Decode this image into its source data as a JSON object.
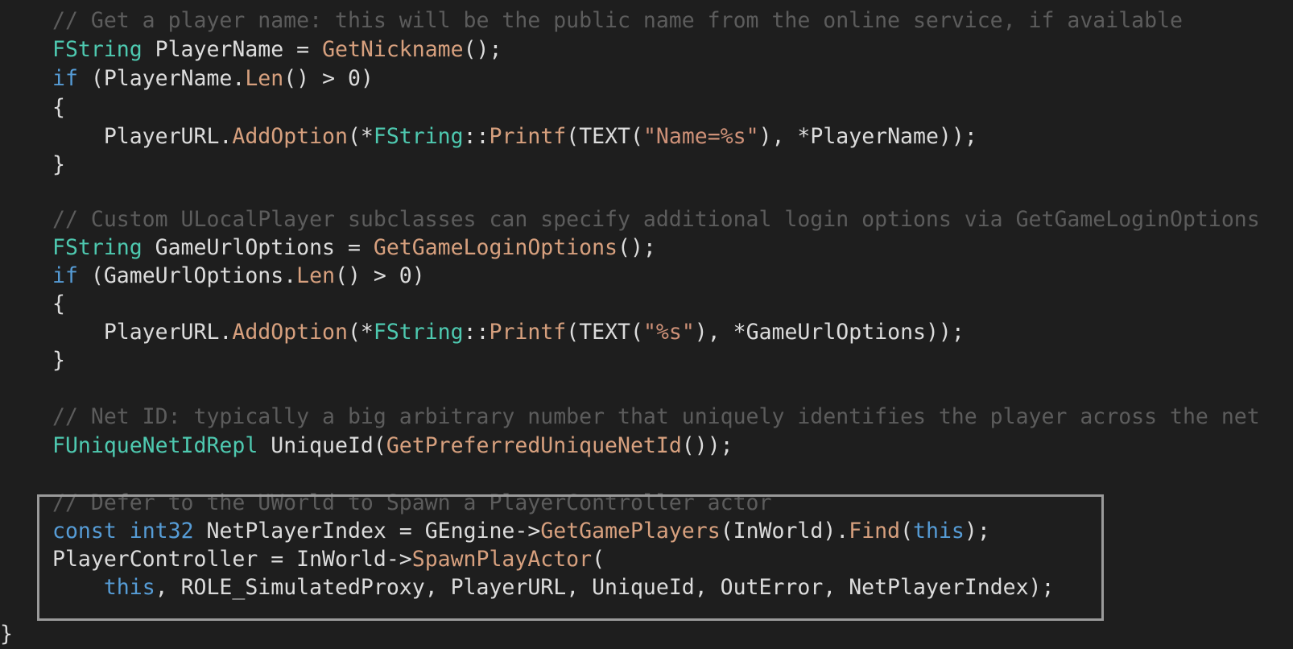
{
  "colors": {
    "background": "#1e1e1e",
    "comment": "#5c5c5c",
    "type": "#4ec9b0",
    "keyword": "#569cd6",
    "function": "#d7a07e",
    "string": "#ce9178",
    "plain": "#dcdcdc",
    "highlight_border": "#9a9a9a"
  },
  "code": {
    "lines": [
      [
        {
          "t": "// Get a player name: this will be the public name from the online service, if available",
          "k": "comment"
        }
      ],
      [
        {
          "t": "FString",
          "k": "type"
        },
        {
          "t": " PlayerName = ",
          "k": "plain"
        },
        {
          "t": "GetNickname",
          "k": "func"
        },
        {
          "t": "();",
          "k": "plain"
        }
      ],
      [
        {
          "t": "if",
          "k": "keyword"
        },
        {
          "t": " (PlayerName.",
          "k": "plain"
        },
        {
          "t": "Len",
          "k": "func"
        },
        {
          "t": "() > 0)",
          "k": "plain"
        }
      ],
      [
        {
          "t": "{",
          "k": "plain"
        }
      ],
      [
        {
          "t": "    PlayerURL.",
          "k": "plain"
        },
        {
          "t": "AddOption",
          "k": "func"
        },
        {
          "t": "(*",
          "k": "plain"
        },
        {
          "t": "FString",
          "k": "type"
        },
        {
          "t": "::",
          "k": "plain"
        },
        {
          "t": "Printf",
          "k": "func"
        },
        {
          "t": "(TEXT(",
          "k": "plain"
        },
        {
          "t": "\"Name=%s\"",
          "k": "string"
        },
        {
          "t": "), *PlayerName));",
          "k": "plain"
        }
      ],
      [
        {
          "t": "}",
          "k": "plain"
        }
      ],
      [],
      [
        {
          "t": "// Custom ULocalPlayer subclasses can specify additional login options via GetGameLoginOptions",
          "k": "comment"
        }
      ],
      [
        {
          "t": "FString",
          "k": "type"
        },
        {
          "t": " GameUrlOptions = ",
          "k": "plain"
        },
        {
          "t": "GetGameLoginOptions",
          "k": "func"
        },
        {
          "t": "();",
          "k": "plain"
        }
      ],
      [
        {
          "t": "if",
          "k": "keyword"
        },
        {
          "t": " (GameUrlOptions.",
          "k": "plain"
        },
        {
          "t": "Len",
          "k": "func"
        },
        {
          "t": "() > 0)",
          "k": "plain"
        }
      ],
      [
        {
          "t": "{",
          "k": "plain"
        }
      ],
      [
        {
          "t": "    PlayerURL.",
          "k": "plain"
        },
        {
          "t": "AddOption",
          "k": "func"
        },
        {
          "t": "(*",
          "k": "plain"
        },
        {
          "t": "FString",
          "k": "type"
        },
        {
          "t": "::",
          "k": "plain"
        },
        {
          "t": "Printf",
          "k": "func"
        },
        {
          "t": "(TEXT(",
          "k": "plain"
        },
        {
          "t": "\"%s\"",
          "k": "string"
        },
        {
          "t": "), *GameUrlOptions));",
          "k": "plain"
        }
      ],
      [
        {
          "t": "}",
          "k": "plain"
        }
      ],
      [],
      [
        {
          "t": "// Net ID: typically a big arbitrary number that uniquely identifies the player across the net",
          "k": "comment"
        }
      ],
      [
        {
          "t": "FUniqueNetIdRepl",
          "k": "type"
        },
        {
          "t": " UniqueId(",
          "k": "plain"
        },
        {
          "t": "GetPreferredUniqueNetId",
          "k": "func"
        },
        {
          "t": "());",
          "k": "plain"
        }
      ],
      [],
      [
        {
          "t": "// Defer to the UWorld to Spawn a PlayerController actor",
          "k": "comment"
        }
      ],
      [
        {
          "t": "const",
          "k": "keyword"
        },
        {
          "t": " ",
          "k": "plain"
        },
        {
          "t": "int32",
          "k": "keyword"
        },
        {
          "t": " NetPlayerIndex = GEngine->",
          "k": "plain"
        },
        {
          "t": "GetGamePlayers",
          "k": "func"
        },
        {
          "t": "(InWorld).",
          "k": "plain"
        },
        {
          "t": "Find",
          "k": "func"
        },
        {
          "t": "(",
          "k": "plain"
        },
        {
          "t": "this",
          "k": "keyword"
        },
        {
          "t": ");",
          "k": "plain"
        }
      ],
      [
        {
          "t": "PlayerController = InWorld->",
          "k": "plain"
        },
        {
          "t": "SpawnPlayActor",
          "k": "func"
        },
        {
          "t": "(",
          "k": "plain"
        }
      ],
      [
        {
          "t": "    ",
          "k": "plain"
        },
        {
          "t": "this",
          "k": "keyword"
        },
        {
          "t": ", ROLE_SimulatedProxy, PlayerURL, UniqueId, OutError, NetPlayerIndex);",
          "k": "plain"
        }
      ]
    ],
    "closing_brace": "}"
  }
}
